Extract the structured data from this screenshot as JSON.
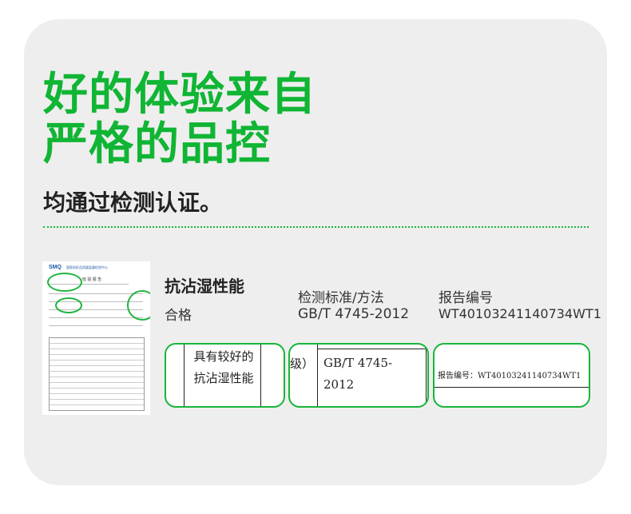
{
  "headline": {
    "line1": "好的体验来自",
    "line2": "严格的品控"
  },
  "subtitle": "均通过检测认证。",
  "report_doc": {
    "header": "SMQ",
    "header_sub": "国家纺织品质量监督检验中心",
    "title": "检 验 报 告"
  },
  "columns": [
    {
      "label": "抗沾湿性能",
      "value": "合格"
    },
    {
      "label": "检测标准/方法",
      "value": "GB/T 4745-2012"
    },
    {
      "label": "报告编号",
      "value": "WT40103241140734WT1"
    }
  ],
  "crops": {
    "c1": "具有较好的抗沾湿性能",
    "c2_left": "级）",
    "c2_right": "GB/T 4745-2012",
    "c3": "报告编号：WT40103241140734WT1"
  },
  "colors": {
    "accent": "#10b534",
    "card": "#eeeeee"
  }
}
